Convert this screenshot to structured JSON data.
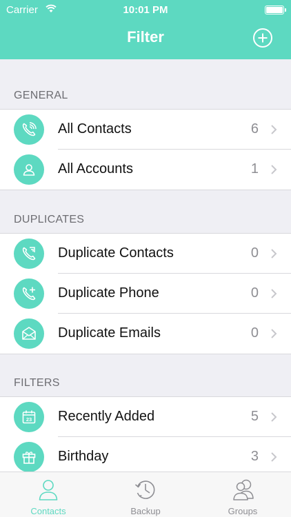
{
  "status_bar": {
    "carrier": "Carrier",
    "time": "10:01 PM"
  },
  "nav": {
    "title": "Filter",
    "add_icon": "plus-circle-icon"
  },
  "sections": [
    {
      "header": "GENERAL",
      "rows": [
        {
          "icon": "phone-ringing-icon",
          "label": "All Contacts",
          "count": "6"
        },
        {
          "icon": "person-icon",
          "label": "All Accounts",
          "count": "1"
        }
      ]
    },
    {
      "header": "DUPLICATES",
      "rows": [
        {
          "icon": "phone-duplicate-icon",
          "label": "Duplicate Contacts",
          "count": "0"
        },
        {
          "icon": "phone-plus-icon",
          "label": "Duplicate Phone",
          "count": "0"
        },
        {
          "icon": "envelope-icon",
          "label": "Duplicate Emails",
          "count": "0"
        }
      ]
    },
    {
      "header": "FILTERS",
      "rows": [
        {
          "icon": "calendar-icon",
          "label": "Recently Added",
          "count": "5",
          "calendar_day": "23"
        },
        {
          "icon": "gift-icon",
          "label": "Birthday",
          "count": "3"
        }
      ]
    }
  ],
  "tabbar": {
    "tabs": [
      {
        "label": "Contacts",
        "icon": "person-outline-icon",
        "active": true
      },
      {
        "label": "Backup",
        "icon": "clock-backup-icon",
        "active": false
      },
      {
        "label": "Groups",
        "icon": "group-icon",
        "active": false
      }
    ]
  },
  "colors": {
    "accent": "#5dd9c1",
    "background": "#efeff4",
    "text": "#111111",
    "secondary": "#8e8e93"
  }
}
